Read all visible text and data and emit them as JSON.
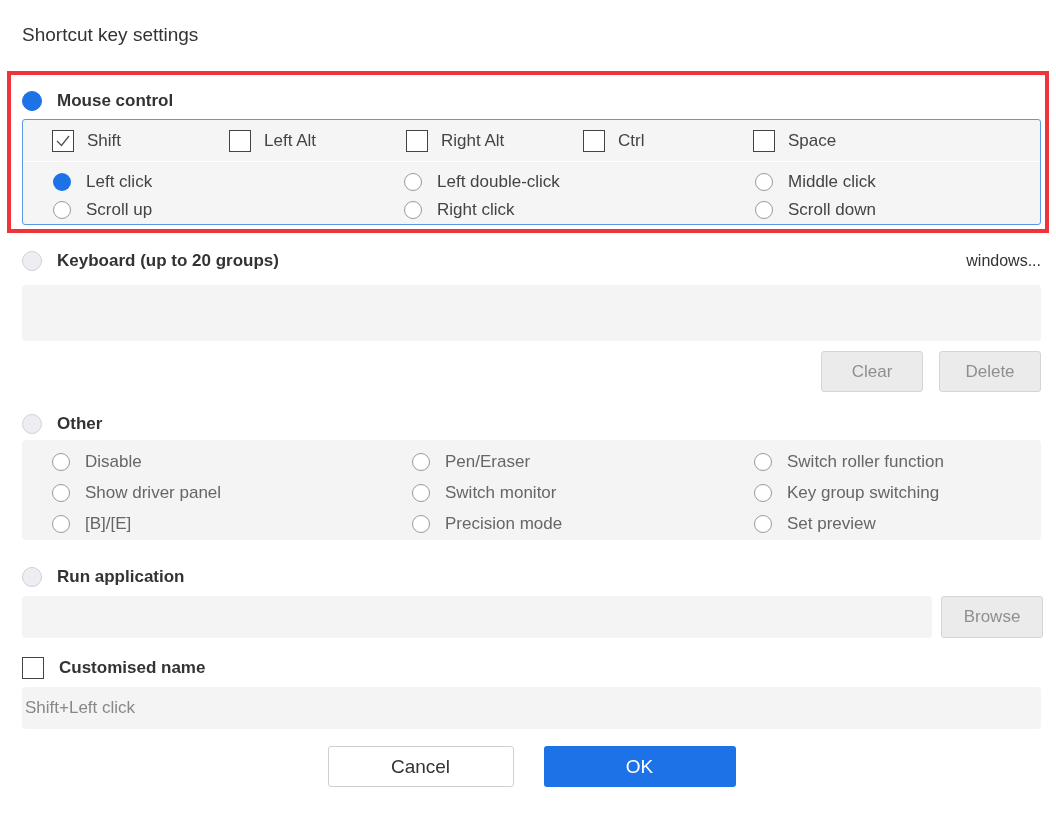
{
  "window": {
    "title": "Shortcut key settings"
  },
  "mouse_control": {
    "label": "Mouse control",
    "selected": true,
    "modifiers": [
      {
        "label": "Shift",
        "checked": true
      },
      {
        "label": "Left Alt",
        "checked": false
      },
      {
        "label": "Right Alt",
        "checked": false
      },
      {
        "label": "Ctrl",
        "checked": false
      },
      {
        "label": "Space",
        "checked": false
      }
    ],
    "buttons": [
      {
        "label": "Left click",
        "selected": true
      },
      {
        "label": "Left double-click",
        "selected": false
      },
      {
        "label": "Middle click",
        "selected": false
      },
      {
        "label": "Scroll up",
        "selected": false
      },
      {
        "label": "Right click",
        "selected": false
      },
      {
        "label": "Scroll down",
        "selected": false
      }
    ]
  },
  "keyboard": {
    "label": "Keyboard (up to 20 groups)",
    "selected": false,
    "platform": "windows...",
    "actions": [
      {
        "label": "Clear",
        "disabled": true
      },
      {
        "label": "Delete",
        "disabled": true
      }
    ]
  },
  "other": {
    "label": "Other",
    "selected": false,
    "disabled": true,
    "options": [
      {
        "label": "Disable",
        "selected": false
      },
      {
        "label": "Pen/Eraser",
        "selected": false
      },
      {
        "label": "Switch roller function",
        "selected": false
      },
      {
        "label": "Show driver panel",
        "selected": false
      },
      {
        "label": "Switch monitor",
        "selected": false
      },
      {
        "label": "Key group switching",
        "selected": false
      },
      {
        "label": "[B]/[E]",
        "selected": false
      },
      {
        "label": "Precision mode",
        "selected": false
      },
      {
        "label": "Set preview",
        "selected": false
      }
    ]
  },
  "run_application": {
    "label": "Run application",
    "selected": false,
    "browse": {
      "label": "Browse",
      "disabled": true
    }
  },
  "customised_name": {
    "label": "Customised name",
    "checked": false,
    "value": "Shift+Left click"
  },
  "buttons": [
    {
      "label": "Cancel",
      "kind": "secondary"
    },
    {
      "label": "OK",
      "kind": "primary"
    }
  ]
}
